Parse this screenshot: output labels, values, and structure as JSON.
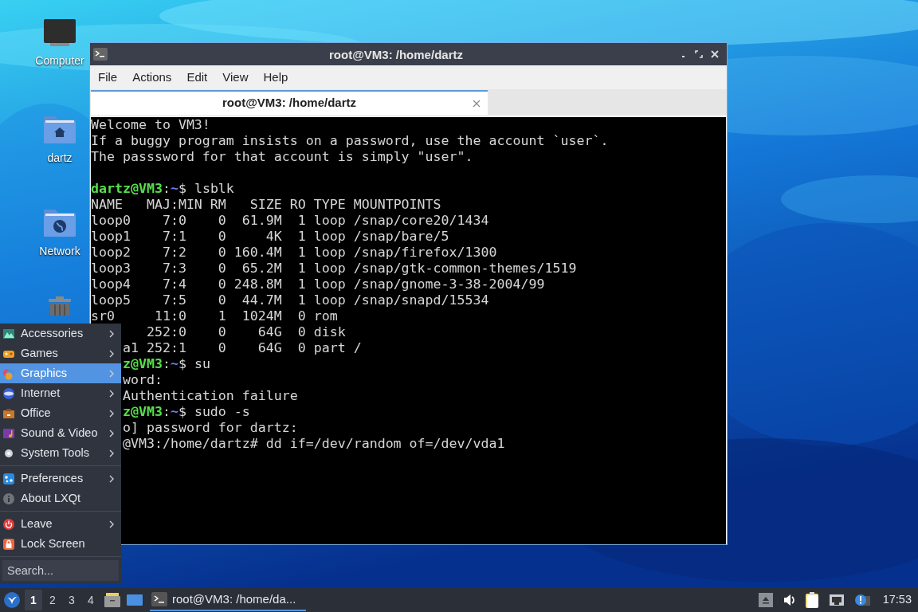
{
  "desktop_icons": [
    {
      "label": "Computer",
      "kind": "computer"
    },
    {
      "label": "dartz",
      "kind": "home"
    },
    {
      "label": "Network",
      "kind": "network"
    },
    {
      "kind": "trash"
    }
  ],
  "window": {
    "title": "root@VM3: /home/dartz",
    "menu": [
      "File",
      "Actions",
      "Edit",
      "View",
      "Help"
    ],
    "tabs": [
      {
        "label": "root@VM3: /home/dartz",
        "selected": true
      }
    ],
    "terminal": {
      "lines": [
        {
          "kind": "output",
          "text": "Welcome to VM3!"
        },
        {
          "kind": "output",
          "text": "If a buggy program insists on a password, use the account `user`."
        },
        {
          "kind": "output",
          "text": "The passsword for that account is simply \"user\"."
        },
        {
          "kind": "blank"
        },
        {
          "kind": "prompt",
          "user": "dartz@VM3",
          "sep": ":",
          "path": "~",
          "command": "$ lsblk"
        },
        {
          "kind": "output",
          "text": "NAME   MAJ:MIN RM   SIZE RO TYPE MOUNTPOINTS"
        },
        {
          "kind": "output",
          "text": "loop0    7:0    0  61.9M  1 loop /snap/core20/1434"
        },
        {
          "kind": "output",
          "text": "loop1    7:1    0     4K  1 loop /snap/bare/5"
        },
        {
          "kind": "output",
          "text": "loop2    7:2    0 160.4M  1 loop /snap/firefox/1300"
        },
        {
          "kind": "output",
          "text": "loop3    7:3    0  65.2M  1 loop /snap/gtk-common-themes/1519"
        },
        {
          "kind": "output",
          "text": "loop4    7:4    0 248.8M  1 loop /snap/gnome-3-38-2004/99"
        },
        {
          "kind": "output",
          "text": "loop5    7:5    0  44.7M  1 loop /snap/snapd/15534"
        },
        {
          "kind": "output",
          "text": "sr0     11:0    1  1024M  0 rom"
        }
      ],
      "lines_beside_menu": [
        {
          "kind": "output",
          "text": "   252:0    0    64G  0 disk"
        },
        {
          "kind": "output",
          "text": "a1 252:1    0    64G  0 part /"
        },
        {
          "kind": "prompt",
          "user": "z@VM3",
          "sep": ":",
          "path": "~",
          "command": "$ su"
        },
        {
          "kind": "output",
          "text": "word:"
        },
        {
          "kind": "output",
          "text": "Authentication failure"
        },
        {
          "kind": "prompt",
          "user": "z@VM3",
          "sep": ":",
          "path": "~",
          "command": "$ sudo -s"
        },
        {
          "kind": "output",
          "text": "o] password for dartz:"
        },
        {
          "kind": "output",
          "text": "@VM3:/home/dartz# dd if=/dev/random of=/dev/vda1"
        }
      ]
    }
  },
  "app_menu": {
    "groups": [
      [
        {
          "label": "Accessories",
          "submenu": true,
          "selected": false
        },
        {
          "label": "Games",
          "submenu": true,
          "selected": false
        },
        {
          "label": "Graphics",
          "submenu": true,
          "selected": true
        },
        {
          "label": "Internet",
          "submenu": true,
          "selected": false
        },
        {
          "label": "Office",
          "submenu": true,
          "selected": false
        },
        {
          "label": "Sound & Video",
          "submenu": true,
          "selected": false
        },
        {
          "label": "System Tools",
          "submenu": true,
          "selected": false
        }
      ],
      [
        {
          "label": "Preferences",
          "submenu": true,
          "selected": false
        },
        {
          "label": "About LXQt",
          "submenu": false,
          "selected": false
        }
      ],
      [
        {
          "label": "Leave",
          "submenu": true,
          "selected": false
        },
        {
          "label": "Lock Screen",
          "submenu": false,
          "selected": false
        }
      ]
    ],
    "search": {
      "placeholder": "Search..."
    }
  },
  "taskbar": {
    "desktops": [
      {
        "label": "1",
        "selected": true
      },
      {
        "label": "2",
        "selected": false
      },
      {
        "label": "3",
        "selected": false
      },
      {
        "label": "4",
        "selected": false
      }
    ],
    "tasks": [
      {
        "label": "root@VM3: /home/da...",
        "selected": true
      }
    ],
    "clock": "17:53"
  }
}
